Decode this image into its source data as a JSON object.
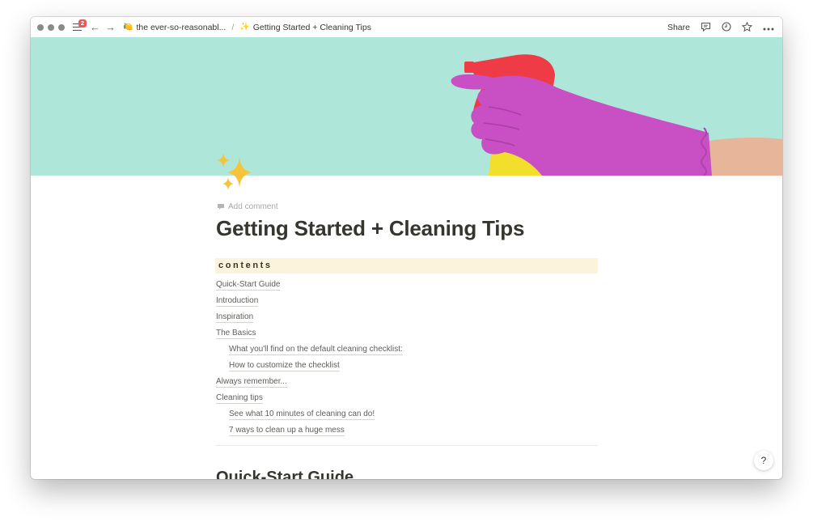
{
  "topbar": {
    "notification_count": "2",
    "back_arrow": "←",
    "forward_arrow": "→",
    "workspace_emoji": "🍋",
    "workspace_name": "the ever-so-reasonabl...",
    "separator": "/",
    "page_emoji": "✨",
    "page_name": "Getting Started + Cleaning Tips",
    "share_label": "Share",
    "comment_icon_name": "comment-icon",
    "history_icon_name": "clock-icon",
    "favorite_icon_name": "star-icon",
    "more_icon_name": "more-icon"
  },
  "page": {
    "icon": "✨",
    "add_comment_label": "Add comment",
    "title": "Getting Started  + Cleaning Tips",
    "contents_heading": "contents",
    "toc": [
      {
        "label": "Quick-Start Guide"
      },
      {
        "label": "Introduction"
      },
      {
        "label": "Inspiration"
      },
      {
        "label": "The Basics"
      },
      {
        "label": "What you'll find on the default cleaning checklist:"
      },
      {
        "label": "How to customize the checklist"
      },
      {
        "label": "Always remember..."
      },
      {
        "label": "Cleaning tips"
      },
      {
        "label": "See what 10 minutes of cleaning can do!"
      },
      {
        "label": "7 ways to clean up a huge mess"
      }
    ],
    "next_heading": "Quick-Start Guide"
  },
  "help_label": "?",
  "colors": {
    "cover_background": "#aee6da",
    "glove": "#c94fc4",
    "bottle": "#f2df2c",
    "sprayer": "#ee3b45",
    "contents_highlight": "#fbf3db",
    "badge": "#eb5757"
  }
}
